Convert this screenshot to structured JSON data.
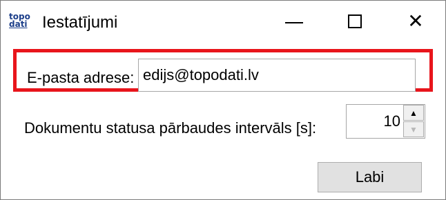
{
  "window": {
    "title": "Iestatījumi",
    "app_icon": {
      "line1": "topo",
      "line2": "dati"
    }
  },
  "titlebar_buttons": {
    "minimize_icon": "minimize-icon",
    "maximize_icon": "maximize-icon",
    "close_icon": "close-icon",
    "close_glyph": "✕"
  },
  "email": {
    "label": "E-pasta adrese:",
    "value": "edijs@topodati.lv"
  },
  "interval": {
    "label": "Dokumentu statusa pārbaudes intervāls [s]:",
    "value": "10",
    "up_glyph": "▲",
    "down_glyph": "▼"
  },
  "actions": {
    "ok_label": "Labi"
  },
  "colors": {
    "highlight": "#e8151b"
  }
}
